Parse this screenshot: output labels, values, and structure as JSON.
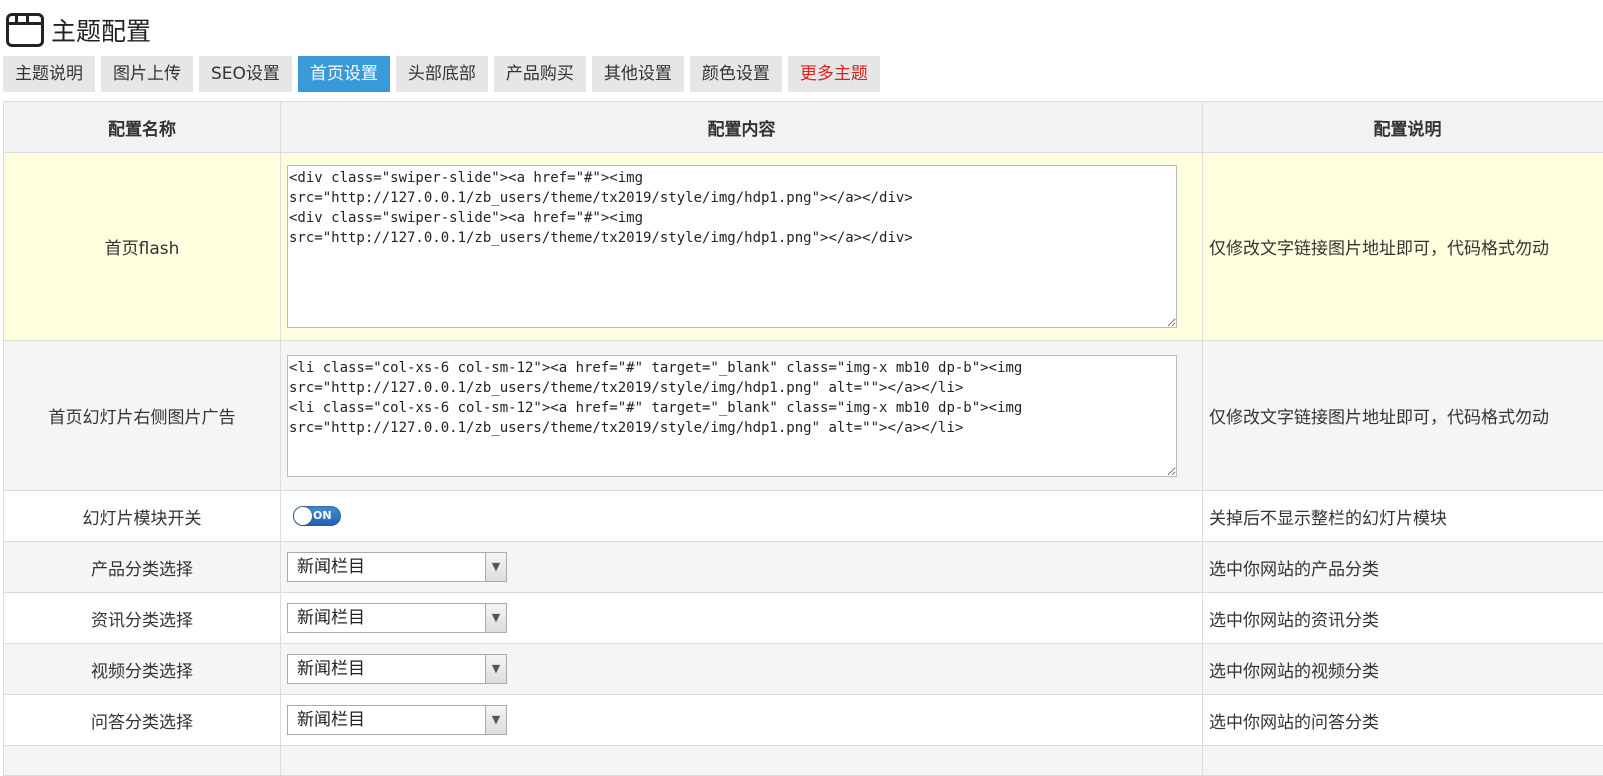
{
  "page": {
    "title": "主题配置"
  },
  "tabs": [
    {
      "label": "主题说明"
    },
    {
      "label": "图片上传"
    },
    {
      "label": "SEO设置"
    },
    {
      "label": "首页设置"
    },
    {
      "label": "头部底部"
    },
    {
      "label": "产品购买"
    },
    {
      "label": "其他设置"
    },
    {
      "label": "颜色设置"
    },
    {
      "label": "更多主题"
    }
  ],
  "table": {
    "headers": {
      "name": "配置名称",
      "content": "配置内容",
      "desc": "配置说明"
    },
    "rows": [
      {
        "name": "首页flash",
        "value": "<div class=\"swiper-slide\"><a href=\"#\"><img src=\"http://127.0.0.1/zb_users/theme/tx2019/style/img/hdp1.png\"></a></div>\n<div class=\"swiper-slide\"><a href=\"#\"><img src=\"http://127.0.0.1/zb_users/theme/tx2019/style/img/hdp1.png\"></a></div>",
        "desc": "仅修改文字链接图片地址即可，代码格式勿动"
      },
      {
        "name": "首页幻灯片右侧图片广告",
        "value": "<li class=\"col-xs-6 col-sm-12\"><a href=\"#\" target=\"_blank\" class=\"img-x mb10 dp-b\"><img src=\"http://127.0.0.1/zb_users/theme/tx2019/style/img/hdp1.png\" alt=\"\"></a></li>\n<li class=\"col-xs-6 col-sm-12\"><a href=\"#\" target=\"_blank\" class=\"img-x mb10 dp-b\"><img src=\"http://127.0.0.1/zb_users/theme/tx2019/style/img/hdp1.png\" alt=\"\"></a></li>",
        "desc": "仅修改文字链接图片地址即可，代码格式勿动"
      },
      {
        "name": "幻灯片模块开关",
        "toggle": "ON",
        "desc": "关掉后不显示整栏的幻灯片模块"
      },
      {
        "name": "产品分类选择",
        "select": "新闻栏目",
        "desc": "选中你网站的产品分类"
      },
      {
        "name": "资讯分类选择",
        "select": "新闻栏目",
        "desc": "选中你网站的资讯分类"
      },
      {
        "name": "视频分类选择",
        "select": "新闻栏目",
        "desc": "选中你网站的视频分类"
      },
      {
        "name": "问答分类选择",
        "select": "新闻栏目",
        "desc": "选中你网站的问答分类"
      }
    ]
  }
}
